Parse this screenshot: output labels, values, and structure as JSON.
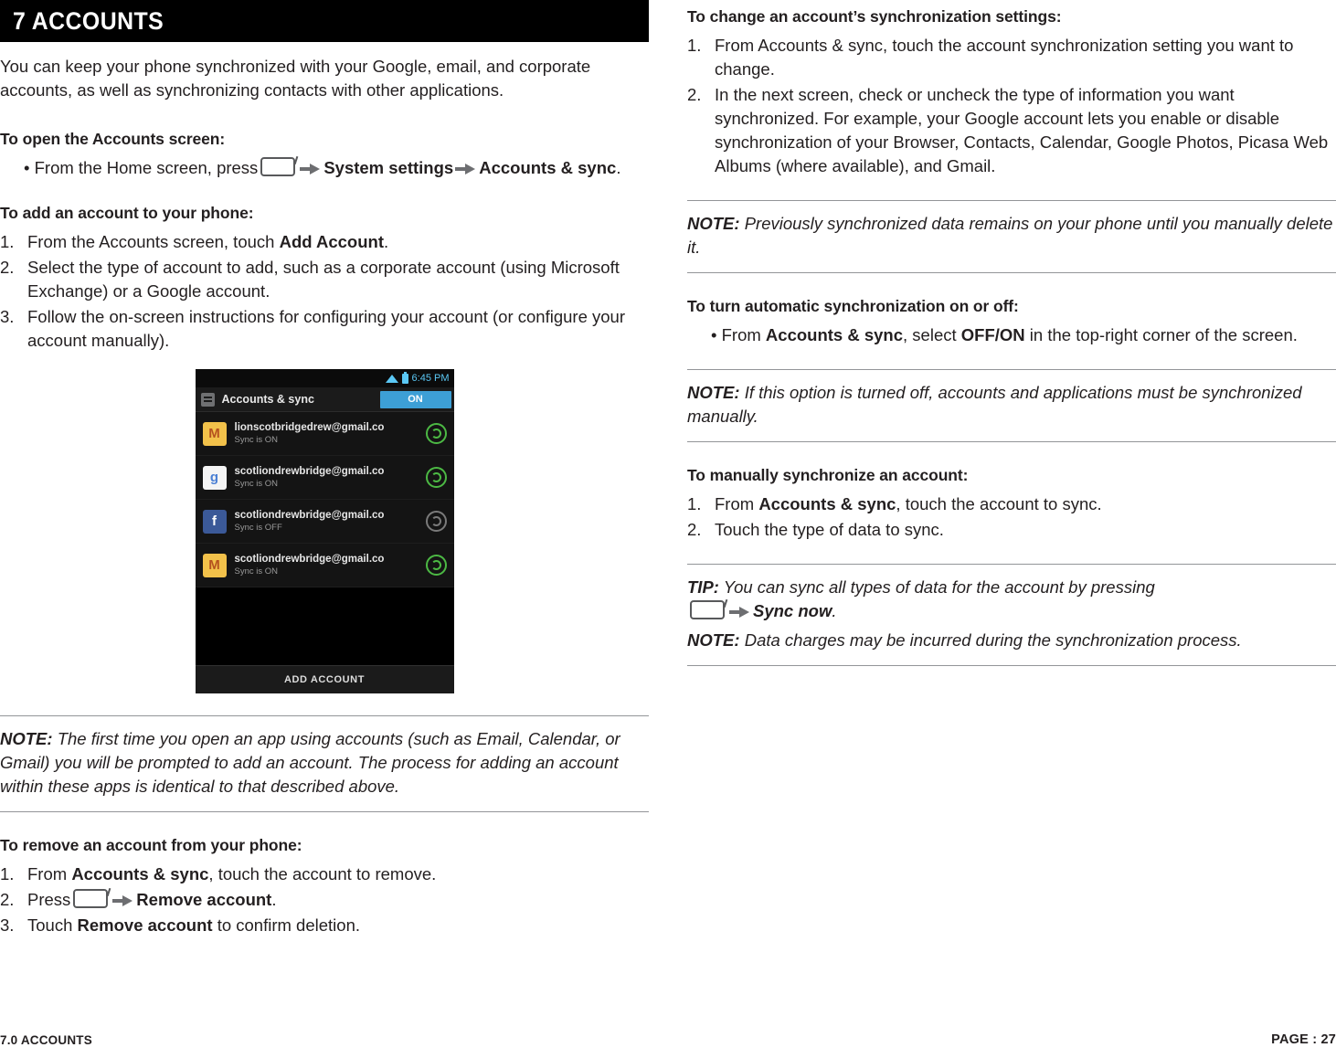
{
  "chapter": {
    "title": "7 ACCOUNTS"
  },
  "left": {
    "intro": "You can keep your phone synchronized with your Google, email, and corporate accounts, as well as synchronizing contacts with other applications.",
    "sections": [
      {
        "heading": "To open the Accounts screen:",
        "bullet_prefix": "• From the Home screen, press",
        "bullet_mid": "System settings",
        "bullet_end": "Accounts & sync",
        "bullet_period": "."
      }
    ],
    "add_account": {
      "heading": "To add an account to your phone:",
      "steps": [
        {
          "num": "1.",
          "pre": "From the Accounts screen, touch ",
          "bold": "Add Account",
          "post": "."
        },
        {
          "num": "2.",
          "pre": "Select the type of account to add, such as a corporate account (using Microsoft Exchange) or a Google account.",
          "bold": "",
          "post": ""
        },
        {
          "num": "3.",
          "pre": "Follow the on-screen instructions for configuring your account (or configure your account manually).",
          "bold": "",
          "post": ""
        }
      ]
    },
    "screenshot": {
      "status_time": "6:45 PM",
      "app_title": "Accounts & sync",
      "toggle_label": "ON",
      "accounts": [
        {
          "icon": "gmail-icon",
          "name": "lionscotbridgedrew@gmail.co",
          "sync": "Sync is ON",
          "state": "on"
        },
        {
          "icon": "google-icon",
          "name": "scotliondrewbridge@gmail.co",
          "sync": "Sync is ON",
          "state": "on"
        },
        {
          "icon": "facebook-icon",
          "name": "scotliondrewbridge@gmail.co",
          "sync": "Sync is OFF",
          "state": "off"
        },
        {
          "icon": "gmail-icon",
          "name": "scotliondrewbridge@gmail.co",
          "sync": "Sync is ON",
          "state": "on"
        }
      ],
      "add_button": "ADD ACCOUNT"
    },
    "note1": {
      "label": "NOTE:",
      "text": " The first time you open an app using accounts (such as Email, Calendar, or Gmail) you will be prompted to add an account. The process for adding an account within these apps is identical to that described above."
    },
    "remove": {
      "heading": "To remove an account from your phone:",
      "steps": [
        {
          "num": "1.",
          "pre": "From ",
          "bold": "Accounts & sync",
          "post": ", touch the account to remove."
        },
        {
          "num": "2.",
          "pre": "Press",
          "bold": "Remove account",
          "post": "."
        },
        {
          "num": "3.",
          "pre": "Touch ",
          "bold": "Remove account",
          "post": " to confirm deletion."
        }
      ]
    }
  },
  "right": {
    "change_sync": {
      "heading": "To change an account’s synchronization settings:",
      "steps": [
        {
          "num": "1.",
          "text": "From Accounts & sync, touch the account synchronization setting you want to change."
        },
        {
          "num": "2.",
          "text": "In the next screen, check or uncheck the type of information you want synchronized. For example, your Google account lets you enable or disable synchronization of your Browser, Contacts, Calendar, Google Photos, Picasa Web Albums (where available), and Gmail."
        }
      ]
    },
    "note_prev": {
      "label": "NOTE:",
      "text": " Previously synchronized data remains on your phone until you manually delete it."
    },
    "auto_sync": {
      "heading": "To turn automatic synchronization on or off:",
      "bullet_pre": "• From ",
      "bullet_b1": "Accounts & sync",
      "bullet_mid": ", select ",
      "bullet_b2": "OFF/ON",
      "bullet_post": " in the top-right corner of the screen."
    },
    "note_off": {
      "label": "NOTE:",
      "text": " If this option is turned off, accounts and applications must be synchronized manually."
    },
    "manual_sync": {
      "heading": "To manually synchronize an account:",
      "steps": [
        {
          "num": "1.",
          "pre": "From ",
          "bold": "Accounts & sync",
          "post": ", touch the account to sync."
        },
        {
          "num": "2.",
          "pre": "Touch the type of data to sync.",
          "bold": "",
          "post": ""
        }
      ]
    },
    "tip": {
      "label": "TIP:",
      "text": " You can sync all types of data for the account by pressing",
      "bold": "Sync now",
      "post": "."
    },
    "note_charges": {
      "label": "NOTE:",
      "text": " Data charges may be incurred during the synchronization process."
    }
  },
  "footer": {
    "left": "7.0 ACCOUNTS",
    "right": "PAGE : 27"
  }
}
